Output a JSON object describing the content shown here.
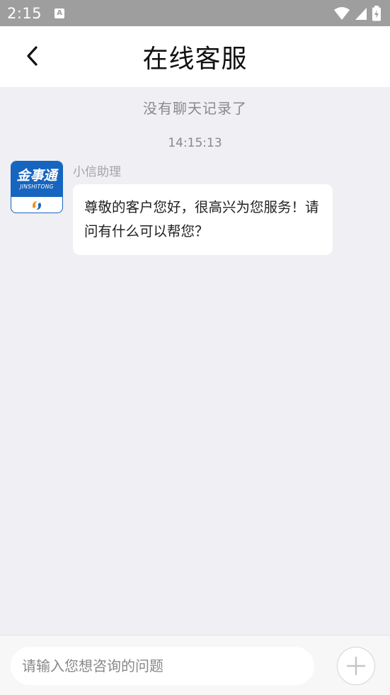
{
  "status_bar": {
    "time": "2:15",
    "notification_icon": "a-letter-icon",
    "icons": [
      "wifi-icon",
      "signal-icon",
      "battery-icon"
    ]
  },
  "header": {
    "title": "在线客服",
    "back_icon": "chevron-left-icon"
  },
  "chat": {
    "no_history_text": "没有聊天记录了",
    "timestamp": "14:15:13",
    "messages": [
      {
        "sender": "小信助理",
        "avatar_brand": "金事通",
        "avatar_brand_sub": "JINSHITONG",
        "text": "尊敬的客户您好，很高兴为您服务！请问有什么可以帮您？"
      }
    ]
  },
  "input_bar": {
    "placeholder": "请输入您想咨询的问题",
    "value": "",
    "plus_icon": "plus-icon"
  },
  "colors": {
    "status_bar_bg": "#9e9e9e",
    "chat_bg": "#efeff4",
    "brand_blue": "#1665c0",
    "brand_orange": "#f28c1b"
  }
}
